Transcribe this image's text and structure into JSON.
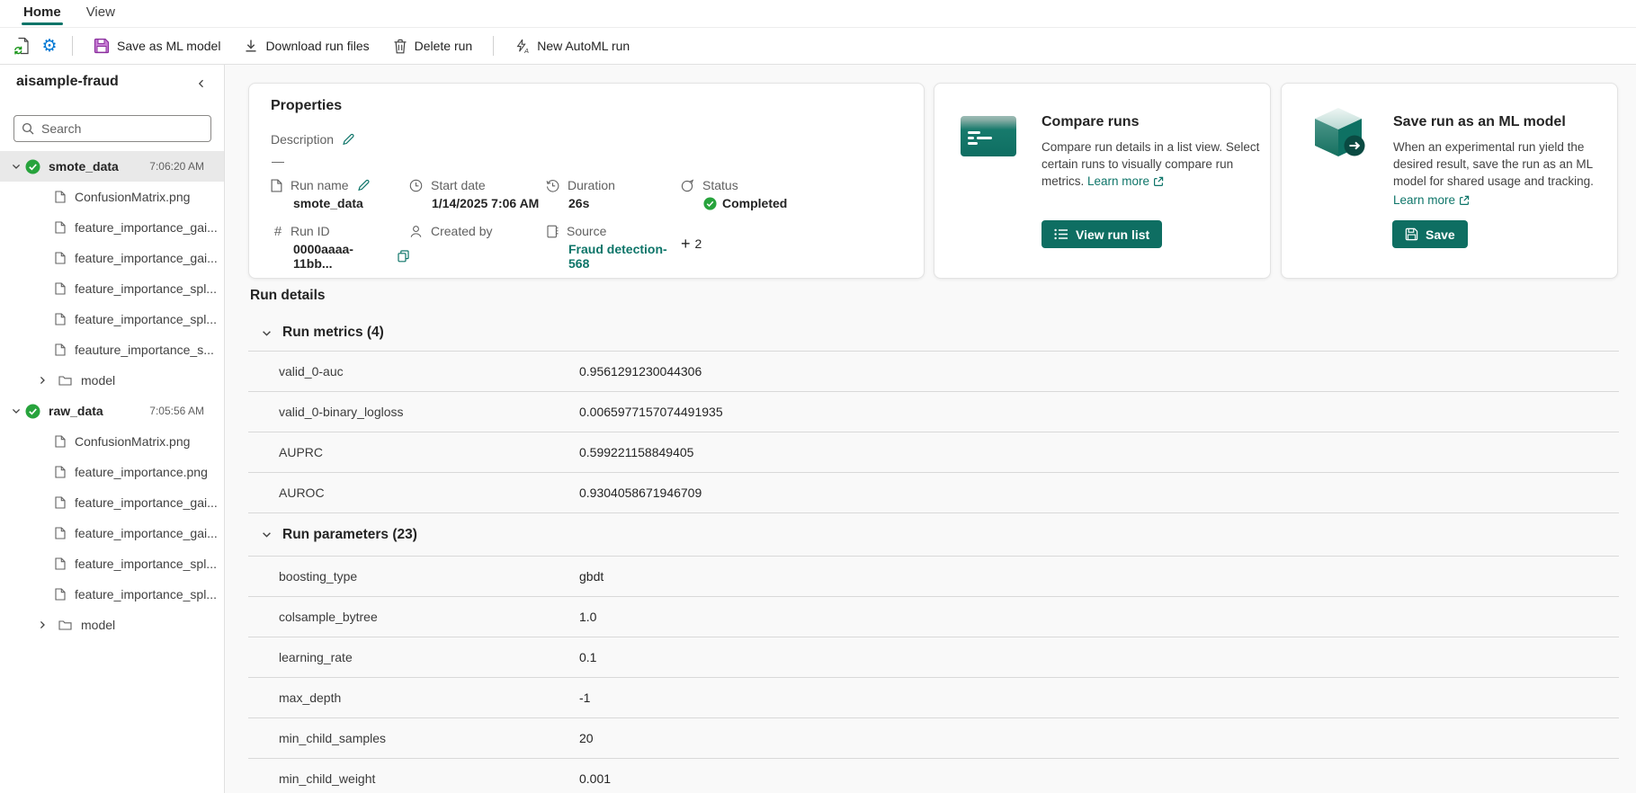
{
  "colors": {
    "accent": "#0E7569",
    "button_teal": "#0E6E62",
    "green": "#27A33C",
    "purple": "#A944BC",
    "blue": "#0078D4"
  },
  "icons": {
    "gear": "⚙",
    "hash": "#",
    "plus": "+",
    "dash": "—",
    "collapse": "‹"
  },
  "tabs": {
    "home": "Home",
    "view": "View"
  },
  "toolbar": {
    "save_model": "Save as ML model",
    "download": "Download run files",
    "delete": "Delete run",
    "automl": "New AutoML run"
  },
  "sidebar": {
    "title": "aisample-fraud",
    "search_placeholder": "Search",
    "tree": [
      {
        "kind": "run",
        "name": "smote_data",
        "time": "7:06:20 AM"
      },
      {
        "kind": "file",
        "name": "ConfusionMatrix.png"
      },
      {
        "kind": "file",
        "name": "feature_importance_gai..."
      },
      {
        "kind": "file",
        "name": "feature_importance_gai..."
      },
      {
        "kind": "file",
        "name": "feature_importance_spl..."
      },
      {
        "kind": "file",
        "name": "feature_importance_spl..."
      },
      {
        "kind": "file",
        "name": "feauture_importance_s..."
      },
      {
        "kind": "folder",
        "name": "model"
      },
      {
        "kind": "run",
        "name": "raw_data",
        "time": "7:05:56 AM"
      },
      {
        "kind": "file",
        "name": "ConfusionMatrix.png"
      },
      {
        "kind": "file",
        "name": "feature_importance.png"
      },
      {
        "kind": "file",
        "name": "feature_importance_gai..."
      },
      {
        "kind": "file",
        "name": "feature_importance_gai..."
      },
      {
        "kind": "file",
        "name": "feature_importance_spl..."
      },
      {
        "kind": "file",
        "name": "feature_importance_spl..."
      },
      {
        "kind": "folder",
        "name": "model"
      }
    ]
  },
  "properties": {
    "title": "Properties",
    "description_label": "Description",
    "description_value": "—",
    "run_name_label": "Run name",
    "run_name_value": "smote_data",
    "start_date_label": "Start date",
    "start_date_value": "1/14/2025 7:06 AM",
    "duration_label": "Duration",
    "duration_value": "26s",
    "status_label": "Status",
    "status_value": "Completed",
    "run_id_label": "Run ID",
    "run_id_value": "0000aaaa-11bb...",
    "created_by_label": "Created by",
    "created_by_value": "",
    "source_label": "Source",
    "source_value": "Fraud detection-568",
    "more_count": "2"
  },
  "compare_card": {
    "title": "Compare runs",
    "body": "Compare run details in a list view. Select certain runs to visually compare run metrics.",
    "learn_more": "Learn more",
    "button": "View run list"
  },
  "save_card": {
    "title": "Save run as an ML model",
    "body": "When an experimental run yield the desired result, save the run as an ML model for shared usage and tracking.",
    "learn_more": "Learn more",
    "button": "Save"
  },
  "run_details": {
    "title": "Run details",
    "metrics": {
      "title": "Run metrics (4)",
      "rows": [
        {
          "name": "valid_0-auc",
          "value": "0.9561291230044306"
        },
        {
          "name": "valid_0-binary_logloss",
          "value": "0.0065977157074491935"
        },
        {
          "name": "AUPRC",
          "value": "0.599221158849405"
        },
        {
          "name": "AUROC",
          "value": "0.9304058671946709"
        }
      ]
    },
    "parameters": {
      "title": "Run parameters (23)",
      "rows": [
        {
          "name": "boosting_type",
          "value": "gbdt"
        },
        {
          "name": "colsample_bytree",
          "value": "1.0"
        },
        {
          "name": "learning_rate",
          "value": "0.1"
        },
        {
          "name": "max_depth",
          "value": "-1"
        },
        {
          "name": "min_child_samples",
          "value": "20"
        },
        {
          "name": "min_child_weight",
          "value": "0.001"
        }
      ]
    }
  }
}
